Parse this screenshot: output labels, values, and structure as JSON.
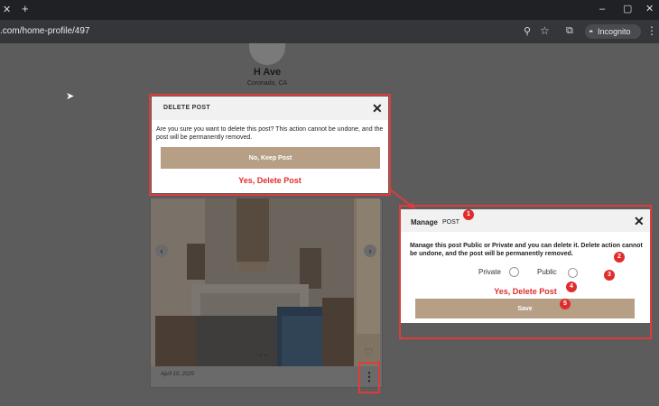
{
  "browser": {
    "url": ".com/home-profile/497",
    "incognito_label": "Incognito"
  },
  "page": {
    "property_title": "H Ave",
    "property_location": "Coronado, CA",
    "card_date": "April 10, 2025"
  },
  "delete_dialog": {
    "title": "DELETE POST",
    "message": "Are you sure you want to delete this post? This action cannot be undone, and the post will be permanently removed.",
    "keep_label": "No, Keep Post",
    "delete_label": "Yes, Delete Post"
  },
  "manage_dialog": {
    "title": "Manage",
    "title_suffix": "POST",
    "message": "Manage this post  Public or Private and you can delete it. Delete action cannot be undone, and the post will be permanently removed.",
    "private_label": "Private",
    "public_label": "Public",
    "delete_label": "Yes, Delete Post",
    "save_label": "Save"
  },
  "markers": [
    "1",
    "2",
    "3",
    "4",
    "5"
  ],
  "colors": {
    "accent_button": "#b69f85",
    "danger_text": "#e02c2c",
    "annotation_border": "#e03b3b"
  }
}
